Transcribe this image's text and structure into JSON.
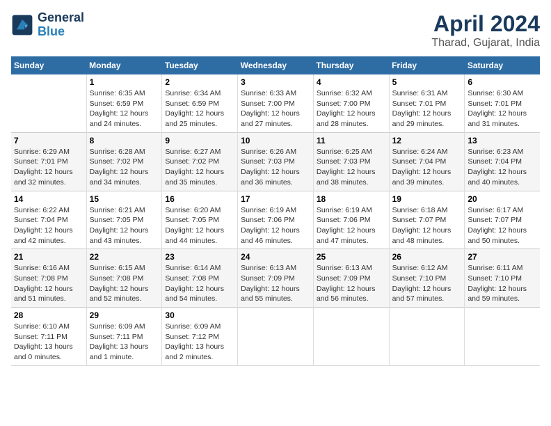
{
  "header": {
    "logo_line1": "General",
    "logo_line2": "Blue",
    "title": "April 2024",
    "subtitle": "Tharad, Gujarat, India"
  },
  "columns": [
    "Sunday",
    "Monday",
    "Tuesday",
    "Wednesday",
    "Thursday",
    "Friday",
    "Saturday"
  ],
  "weeks": [
    [
      {
        "day": "",
        "info": ""
      },
      {
        "day": "1",
        "info": "Sunrise: 6:35 AM\nSunset: 6:59 PM\nDaylight: 12 hours\nand 24 minutes."
      },
      {
        "day": "2",
        "info": "Sunrise: 6:34 AM\nSunset: 6:59 PM\nDaylight: 12 hours\nand 25 minutes."
      },
      {
        "day": "3",
        "info": "Sunrise: 6:33 AM\nSunset: 7:00 PM\nDaylight: 12 hours\nand 27 minutes."
      },
      {
        "day": "4",
        "info": "Sunrise: 6:32 AM\nSunset: 7:00 PM\nDaylight: 12 hours\nand 28 minutes."
      },
      {
        "day": "5",
        "info": "Sunrise: 6:31 AM\nSunset: 7:01 PM\nDaylight: 12 hours\nand 29 minutes."
      },
      {
        "day": "6",
        "info": "Sunrise: 6:30 AM\nSunset: 7:01 PM\nDaylight: 12 hours\nand 31 minutes."
      }
    ],
    [
      {
        "day": "7",
        "info": "Sunrise: 6:29 AM\nSunset: 7:01 PM\nDaylight: 12 hours\nand 32 minutes."
      },
      {
        "day": "8",
        "info": "Sunrise: 6:28 AM\nSunset: 7:02 PM\nDaylight: 12 hours\nand 34 minutes."
      },
      {
        "day": "9",
        "info": "Sunrise: 6:27 AM\nSunset: 7:02 PM\nDaylight: 12 hours\nand 35 minutes."
      },
      {
        "day": "10",
        "info": "Sunrise: 6:26 AM\nSunset: 7:03 PM\nDaylight: 12 hours\nand 36 minutes."
      },
      {
        "day": "11",
        "info": "Sunrise: 6:25 AM\nSunset: 7:03 PM\nDaylight: 12 hours\nand 38 minutes."
      },
      {
        "day": "12",
        "info": "Sunrise: 6:24 AM\nSunset: 7:04 PM\nDaylight: 12 hours\nand 39 minutes."
      },
      {
        "day": "13",
        "info": "Sunrise: 6:23 AM\nSunset: 7:04 PM\nDaylight: 12 hours\nand 40 minutes."
      }
    ],
    [
      {
        "day": "14",
        "info": "Sunrise: 6:22 AM\nSunset: 7:04 PM\nDaylight: 12 hours\nand 42 minutes."
      },
      {
        "day": "15",
        "info": "Sunrise: 6:21 AM\nSunset: 7:05 PM\nDaylight: 12 hours\nand 43 minutes."
      },
      {
        "day": "16",
        "info": "Sunrise: 6:20 AM\nSunset: 7:05 PM\nDaylight: 12 hours\nand 44 minutes."
      },
      {
        "day": "17",
        "info": "Sunrise: 6:19 AM\nSunset: 7:06 PM\nDaylight: 12 hours\nand 46 minutes."
      },
      {
        "day": "18",
        "info": "Sunrise: 6:19 AM\nSunset: 7:06 PM\nDaylight: 12 hours\nand 47 minutes."
      },
      {
        "day": "19",
        "info": "Sunrise: 6:18 AM\nSunset: 7:07 PM\nDaylight: 12 hours\nand 48 minutes."
      },
      {
        "day": "20",
        "info": "Sunrise: 6:17 AM\nSunset: 7:07 PM\nDaylight: 12 hours\nand 50 minutes."
      }
    ],
    [
      {
        "day": "21",
        "info": "Sunrise: 6:16 AM\nSunset: 7:08 PM\nDaylight: 12 hours\nand 51 minutes."
      },
      {
        "day": "22",
        "info": "Sunrise: 6:15 AM\nSunset: 7:08 PM\nDaylight: 12 hours\nand 52 minutes."
      },
      {
        "day": "23",
        "info": "Sunrise: 6:14 AM\nSunset: 7:08 PM\nDaylight: 12 hours\nand 54 minutes."
      },
      {
        "day": "24",
        "info": "Sunrise: 6:13 AM\nSunset: 7:09 PM\nDaylight: 12 hours\nand 55 minutes."
      },
      {
        "day": "25",
        "info": "Sunrise: 6:13 AM\nSunset: 7:09 PM\nDaylight: 12 hours\nand 56 minutes."
      },
      {
        "day": "26",
        "info": "Sunrise: 6:12 AM\nSunset: 7:10 PM\nDaylight: 12 hours\nand 57 minutes."
      },
      {
        "day": "27",
        "info": "Sunrise: 6:11 AM\nSunset: 7:10 PM\nDaylight: 12 hours\nand 59 minutes."
      }
    ],
    [
      {
        "day": "28",
        "info": "Sunrise: 6:10 AM\nSunset: 7:11 PM\nDaylight: 13 hours\nand 0 minutes."
      },
      {
        "day": "29",
        "info": "Sunrise: 6:09 AM\nSunset: 7:11 PM\nDaylight: 13 hours\nand 1 minute."
      },
      {
        "day": "30",
        "info": "Sunrise: 6:09 AM\nSunset: 7:12 PM\nDaylight: 13 hours\nand 2 minutes."
      },
      {
        "day": "",
        "info": ""
      },
      {
        "day": "",
        "info": ""
      },
      {
        "day": "",
        "info": ""
      },
      {
        "day": "",
        "info": ""
      }
    ]
  ]
}
